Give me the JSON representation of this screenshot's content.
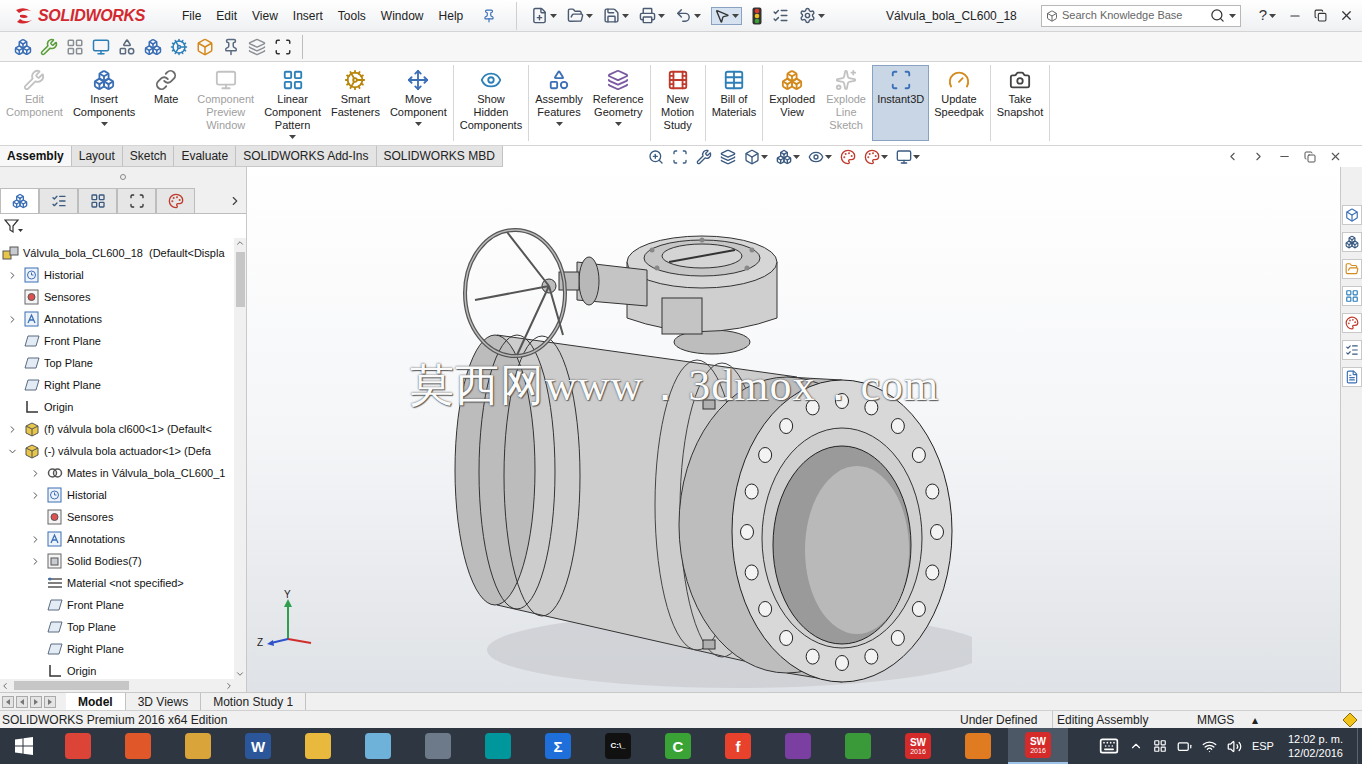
{
  "app": {
    "brand": "SOLIDWORKS"
  },
  "menu": [
    "File",
    "Edit",
    "View",
    "Insert",
    "Tools",
    "Window",
    "Help"
  ],
  "window": {
    "title": "Válvula_bola_CL600_18"
  },
  "search": {
    "placeholder": "Search Knowledge Base"
  },
  "help": "?",
  "command_groups": [
    [
      {
        "lines": [
          "Edit",
          "Component"
        ],
        "disabled": true,
        "dropdown": false,
        "selected": false
      },
      {
        "lines": [
          "Insert",
          "Components"
        ],
        "disabled": false,
        "dropdown": true,
        "selected": false
      },
      {
        "lines": [
          "Mate"
        ],
        "disabled": false,
        "dropdown": false,
        "selected": false
      },
      {
        "lines": [
          "Component",
          "Preview",
          "Window"
        ],
        "disabled": true,
        "dropdown": false,
        "selected": false
      },
      {
        "lines": [
          "Linear",
          "Component",
          "Pattern"
        ],
        "disabled": false,
        "dropdown": true,
        "selected": false
      },
      {
        "lines": [
          "Smart",
          "Fasteners"
        ],
        "disabled": false,
        "dropdown": false,
        "selected": false
      },
      {
        "lines": [
          "Move",
          "Component"
        ],
        "disabled": false,
        "dropdown": true,
        "selected": false
      }
    ],
    [
      {
        "lines": [
          "Show",
          "Hidden",
          "Components"
        ],
        "disabled": false,
        "dropdown": false,
        "selected": false
      }
    ],
    [
      {
        "lines": [
          "Assembly",
          "Features"
        ],
        "disabled": false,
        "dropdown": true,
        "selected": false
      },
      {
        "lines": [
          "Reference",
          "Geometry"
        ],
        "disabled": false,
        "dropdown": true,
        "selected": false
      }
    ],
    [
      {
        "lines": [
          "New",
          "Motion",
          "Study"
        ],
        "disabled": false,
        "dropdown": false,
        "selected": false
      }
    ],
    [
      {
        "lines": [
          "Bill of",
          "Materials"
        ],
        "disabled": false,
        "dropdown": false,
        "selected": false
      }
    ],
    [
      {
        "lines": [
          "Exploded",
          "View"
        ],
        "disabled": false,
        "dropdown": false,
        "selected": false
      },
      {
        "lines": [
          "Explode",
          "Line",
          "Sketch"
        ],
        "disabled": true,
        "dropdown": false,
        "selected": false
      },
      {
        "lines": [
          "Instant3D"
        ],
        "disabled": false,
        "dropdown": false,
        "selected": true
      },
      {
        "lines": [
          "Update",
          "Speedpak"
        ],
        "disabled": false,
        "dropdown": false,
        "selected": false
      }
    ],
    [
      {
        "lines": [
          "Take",
          "Snapshot"
        ],
        "disabled": false,
        "dropdown": false,
        "selected": false
      }
    ]
  ],
  "tabs": [
    {
      "label": "Assembly",
      "selected": true
    },
    {
      "label": "Layout",
      "selected": false
    },
    {
      "label": "Sketch",
      "selected": false
    },
    {
      "label": "Evaluate",
      "selected": false
    },
    {
      "label": "SOLIDWORKS Add-Ins",
      "selected": false
    },
    {
      "label": "SOLIDWORKS MBD",
      "selected": false
    }
  ],
  "panel_tabs": [
    {
      "selected": true
    },
    {
      "selected": false
    },
    {
      "selected": false
    },
    {
      "selected": false
    },
    {
      "selected": false
    }
  ],
  "tree": [
    {
      "label": "Válvula_bola_CL600_18  (Default<Displa",
      "level": 0,
      "kind": "assembly",
      "expandable": false,
      "expanded": false
    },
    {
      "label": "Historial",
      "level": 1,
      "kind": "history",
      "expandable": true,
      "expanded": false
    },
    {
      "label": "Sensores",
      "level": 1,
      "kind": "sensor",
      "expandable": false,
      "expanded": false
    },
    {
      "label": "Annotations",
      "level": 1,
      "kind": "annotation",
      "expandable": true,
      "expanded": false
    },
    {
      "label": "Front Plane",
      "level": 1,
      "kind": "plane",
      "expandable": false,
      "expanded": false
    },
    {
      "label": "Top Plane",
      "level": 1,
      "kind": "plane",
      "expandable": false,
      "expanded": false
    },
    {
      "label": "Right Plane",
      "level": 1,
      "kind": "plane",
      "expandable": false,
      "expanded": false
    },
    {
      "label": "Origin",
      "level": 1,
      "kind": "origin",
      "expandable": false,
      "expanded": false
    },
    {
      "label": "(f) válvula bola cl600<1> (Default<",
      "level": 1,
      "kind": "part",
      "expandable": true,
      "expanded": false
    },
    {
      "label": "(-) válvula bola actuador<1> (Defa",
      "level": 1,
      "kind": "part",
      "expandable": true,
      "expanded": true
    },
    {
      "label": "Mates in Válvula_bola_CL600_1",
      "level": 2,
      "kind": "mates",
      "expandable": true,
      "expanded": false
    },
    {
      "label": "Historial",
      "level": 2,
      "kind": "history",
      "expandable": true,
      "expanded": false
    },
    {
      "label": "Sensores",
      "level": 2,
      "kind": "sensor",
      "expandable": false,
      "expanded": false
    },
    {
      "label": "Annotations",
      "level": 2,
      "kind": "annotation",
      "expandable": true,
      "expanded": false
    },
    {
      "label": "Solid Bodies(7)",
      "level": 2,
      "kind": "bodies",
      "expandable": true,
      "expanded": false
    },
    {
      "label": "Material <not specified>",
      "level": 2,
      "kind": "material",
      "expandable": false,
      "expanded": false
    },
    {
      "label": "Front Plane",
      "level": 2,
      "kind": "plane",
      "expandable": false,
      "expanded": false
    },
    {
      "label": "Top Plane",
      "level": 2,
      "kind": "plane",
      "expandable": false,
      "expanded": false
    },
    {
      "label": "Right Plane",
      "level": 2,
      "kind": "plane",
      "expandable": false,
      "expanded": false
    },
    {
      "label": "Origin",
      "level": 2,
      "kind": "origin",
      "expandable": false,
      "expanded": false
    }
  ],
  "viewport": {
    "watermark": "莫西网www．3dmox．com",
    "triad": {
      "y": "Y",
      "z": "Z"
    }
  },
  "bottom_tabs": [
    {
      "label": "Model",
      "selected": true
    },
    {
      "label": "3D Views",
      "selected": false
    },
    {
      "label": "Motion Study 1",
      "selected": false
    }
  ],
  "status_bar": {
    "edition": "SOLIDWORKS Premium 2016 x64 Edition",
    "cells": [
      "Under Defined",
      "Editing Assembly",
      "MMGS"
    ],
    "units_arrow": "▴"
  },
  "taskbar": {
    "apps": [
      {
        "glyph": "",
        "sub": "",
        "color": "#db4437",
        "active": false
      },
      {
        "glyph": "",
        "sub": "",
        "color": "#e0572a",
        "active": false
      },
      {
        "glyph": "",
        "sub": "",
        "color": "#d9a43a",
        "active": false
      },
      {
        "glyph": "W",
        "sub": "",
        "color": "#2b579a",
        "active": false
      },
      {
        "glyph": "",
        "sub": "",
        "color": "#e8b93c",
        "active": false
      },
      {
        "glyph": "",
        "sub": "",
        "color": "#6fb2d9",
        "active": false
      },
      {
        "glyph": "",
        "sub": "",
        "color": "#6c7a89",
        "active": false
      },
      {
        "glyph": "",
        "sub": "",
        "color": "#00979c",
        "active": false
      },
      {
        "glyph": "Σ",
        "sub": "",
        "color": "#1e6fd9",
        "active": false
      },
      {
        "glyph": "C:\\_",
        "sub": "",
        "color": "#111111",
        "active": false
      },
      {
        "glyph": "C",
        "sub": "",
        "color": "#3aa335",
        "active": false
      },
      {
        "glyph": "f",
        "sub": "",
        "color": "#e8412c",
        "active": false
      },
      {
        "glyph": "",
        "sub": "",
        "color": "#7a3fa0",
        "active": false
      },
      {
        "glyph": "",
        "sub": "",
        "color": "#3a9a3a",
        "active": false
      },
      {
        "glyph": "SW",
        "sub": "2016",
        "color": "#d42a2a",
        "active": false
      },
      {
        "glyph": "",
        "sub": "",
        "color": "#e07b22",
        "active": false
      },
      {
        "glyph": "SW",
        "sub": "2016",
        "color": "#d42a2a",
        "active": true
      }
    ],
    "tray": {
      "language": "ESP",
      "time": "12:02 p. m.",
      "date": "12/02/2016"
    }
  }
}
